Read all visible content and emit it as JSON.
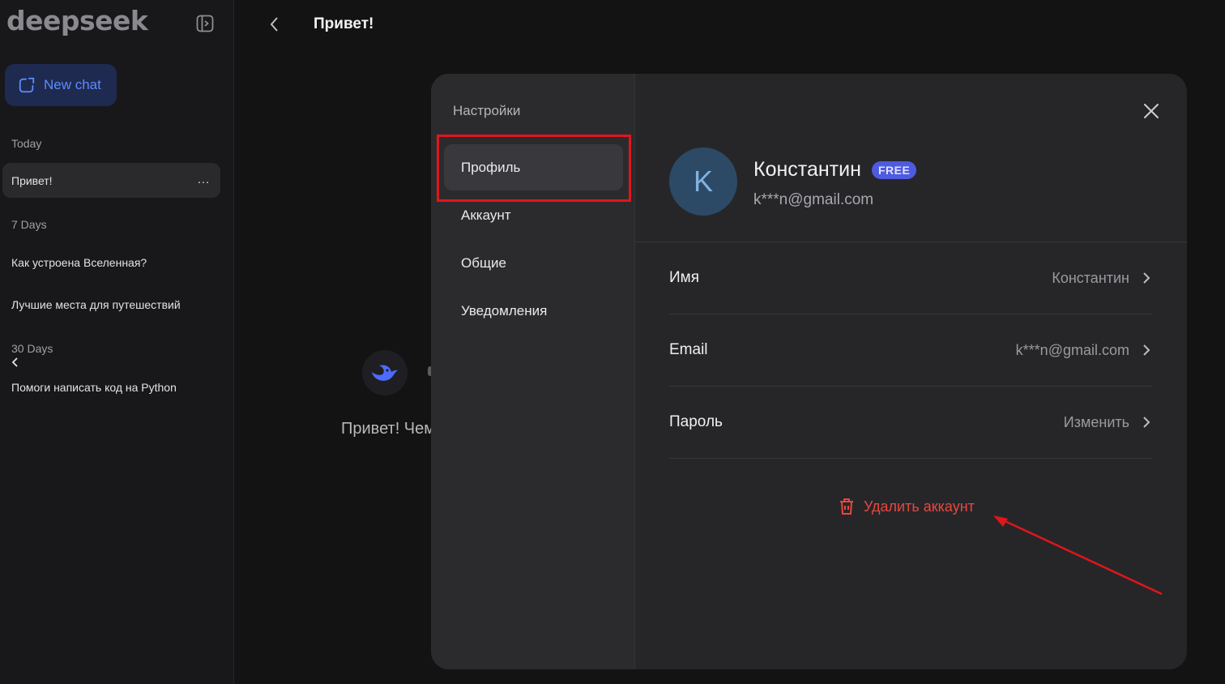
{
  "app": {
    "logo": "deepseek"
  },
  "sidebar": {
    "new_chat_label": "New chat",
    "sections": [
      {
        "label": "Today",
        "items": [
          "Привет!"
        ]
      },
      {
        "label": "7 Days",
        "items": [
          "Как устроена Вселенная?",
          "Лучшие места для путешествий"
        ]
      },
      {
        "label": "30 Days",
        "items": [
          "Помоги написать код на Python"
        ]
      }
    ],
    "more_icon": "…"
  },
  "topbar": {
    "title": "Привет!"
  },
  "background": {
    "greeting": "Привет! Чем"
  },
  "settings": {
    "title": "Настройки",
    "nav": [
      "Профиль",
      "Аккаунт",
      "Общие",
      "Уведомления"
    ],
    "profile": {
      "avatar_letter": "K",
      "name": "Константин",
      "badge": "FREE",
      "email": "k***n@gmail.com",
      "rows": [
        {
          "label": "Имя",
          "value": "Константин"
        },
        {
          "label": "Email",
          "value": "k***n@gmail.com"
        },
        {
          "label": "Пароль",
          "value": "Изменить"
        }
      ],
      "delete_label": "Удалить аккаунт"
    }
  },
  "colors": {
    "accent": "#5d8bff",
    "danger": "#e8473f",
    "highlight": "#e0161b",
    "badge": "#4e5ae0"
  }
}
